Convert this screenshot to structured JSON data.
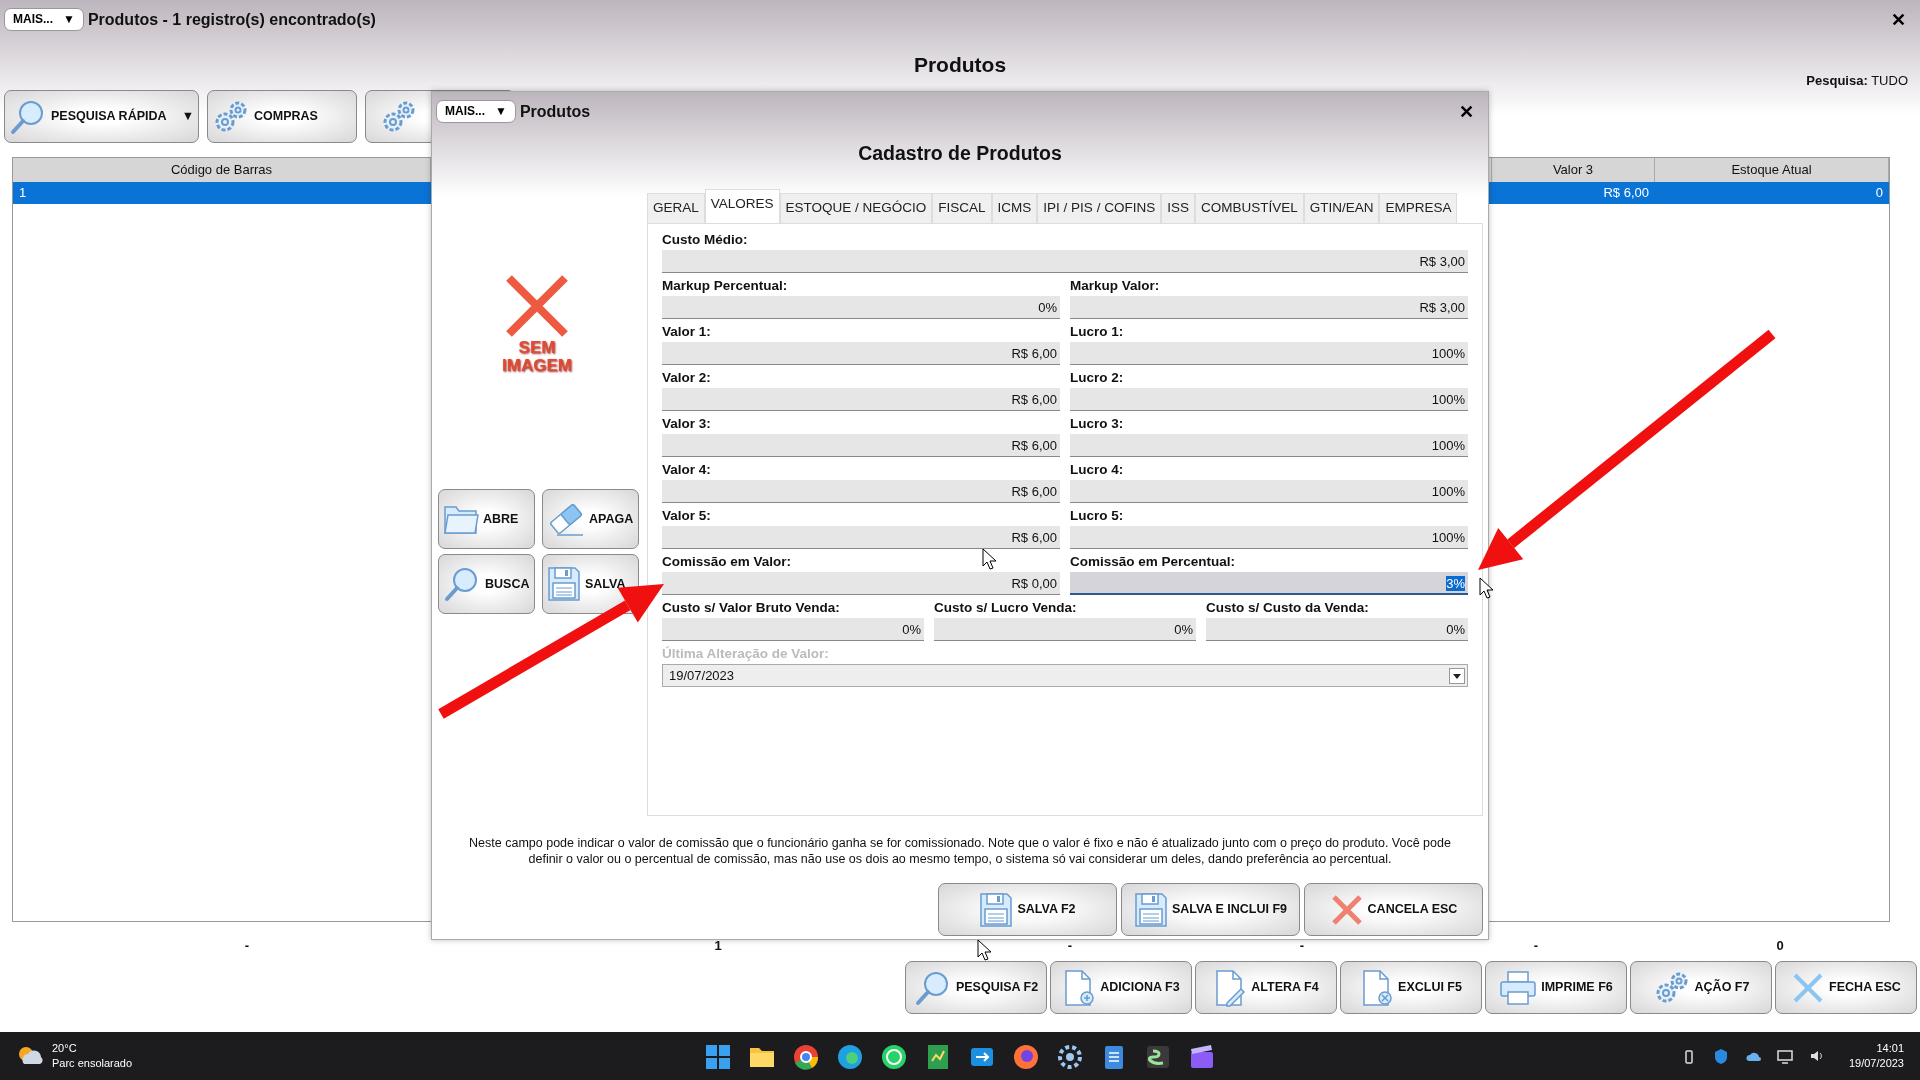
{
  "window": {
    "menu_button": {
      "label": "MAIS...",
      "caret": "▼"
    },
    "title": "Produtos - 1 registro(s) encontrado(s)",
    "close": "✕",
    "heading": "Produtos",
    "search_scope": "**Pesquisa:** TUDO"
  },
  "toolbar": [
    {
      "kind": "button",
      "label": "PESQUISA RÁPIDA",
      "caret": "▼"
    },
    {
      "kind": "button",
      "label": "COMPRAS"
    },
    {
      "kind": "icon-only"
    }
  ],
  "table": {
    "columns": [
      "Código de Barras",
      "Valor 3",
      "Estoque Atual"
    ],
    "rows": [
      {
        "selected": true,
        "cells": [
          "1",
          "R$ 6,00",
          "0"
        ]
      }
    ],
    "totals": [
      "-",
      "1",
      "-",
      "-",
      "-",
      "0"
    ]
  },
  "dialog": {
    "menu_button": {
      "label": "MAIS...",
      "caret": "▼"
    },
    "title": "Produtos",
    "close": "✕",
    "heading": "Cadastro de Produtos",
    "image_placeholder": "SEM IMAGEM",
    "side_buttons": [
      "ABRE",
      "APAGA",
      "BUSCA",
      "SALVA"
    ],
    "tabs": [
      {
        "label": "GERAL",
        "selected": false
      },
      {
        "label": "VALORES",
        "selected": true
      },
      {
        "label": "ESTOQUE / NEGÓCIO",
        "selected": false
      },
      {
        "label": "FISCAL",
        "selected": false
      },
      {
        "label": "ICMS",
        "selected": false
      },
      {
        "label": "IPI / PIS / COFINS",
        "selected": false
      },
      {
        "label": "ISS",
        "selected": false
      },
      {
        "label": "COMBUSTÍVEL",
        "selected": false
      },
      {
        "label": "GTIN/EAN",
        "selected": false
      },
      {
        "label": "EMPRESA",
        "selected": false
      }
    ],
    "field_rows": [
      [
        {
          "kind": "text",
          "label": "Custo Médio:",
          "value": "R$ 3,00",
          "focused": false,
          "disabled": false
        }
      ],
      [
        {
          "kind": "text",
          "label": "Markup Percentual:",
          "value": "0%",
          "focused": false,
          "disabled": false
        },
        {
          "kind": "text",
          "label": "Markup Valor:",
          "value": "R$ 3,00",
          "focused": false,
          "disabled": false
        }
      ],
      [
        {
          "kind": "text",
          "label": "Valor 1:",
          "value": "R$ 6,00",
          "focused": false,
          "disabled": false
        },
        {
          "kind": "text",
          "label": "Lucro 1:",
          "value": "100%",
          "focused": false,
          "disabled": false
        }
      ],
      [
        {
          "kind": "text",
          "label": "Valor 2:",
          "value": "R$ 6,00",
          "focused": false,
          "disabled": false
        },
        {
          "kind": "text",
          "label": "Lucro 2:",
          "value": "100%",
          "focused": false,
          "disabled": false
        }
      ],
      [
        {
          "kind": "text",
          "label": "Valor 3:",
          "value": "R$ 6,00",
          "focused": false,
          "disabled": false
        },
        {
          "kind": "text",
          "label": "Lucro 3:",
          "value": "100%",
          "focused": false,
          "disabled": false
        }
      ],
      [
        {
          "kind": "text",
          "label": "Valor 4:",
          "value": "R$ 6,00",
          "focused": false,
          "disabled": false
        },
        {
          "kind": "text",
          "label": "Lucro 4:",
          "value": "100%",
          "focused": false,
          "disabled": false
        }
      ],
      [
        {
          "kind": "text",
          "label": "Valor 5:",
          "value": "R$ 6,00",
          "focused": false,
          "disabled": false
        },
        {
          "kind": "text",
          "label": "Lucro 5:",
          "value": "100%",
          "focused": false,
          "disabled": false
        }
      ],
      [
        {
          "kind": "text",
          "label": "Comissão em Valor:",
          "value": "R$ 0,00",
          "focused": false,
          "disabled": false
        },
        {
          "kind": "text",
          "label": "Comissão em Percentual:",
          "value": "3%",
          "focused": true,
          "disabled": false
        }
      ],
      [
        {
          "kind": "text",
          "label": "Custo s/ Valor Bruto Venda:",
          "value": "0%",
          "focused": false,
          "disabled": false
        },
        {
          "kind": "text",
          "label": "Custo s/ Lucro Venda:",
          "value": "0%",
          "focused": false,
          "disabled": false
        },
        {
          "kind": "text",
          "label": "Custo s/ Custo da Venda:",
          "value": "0%",
          "focused": false,
          "disabled": false
        }
      ],
      [
        {
          "kind": "select",
          "label": "Última Alteração de Valor:",
          "value": "19/07/2023",
          "focused": false,
          "disabled": true
        }
      ]
    ],
    "help_text": "Neste campo pode indicar o valor de comissão que o funcionário ganha se for comissionado. Note que o valor é fixo e não é atualizado junto com o preço do produto. Você pode definir o valor ou o percentual de comissão, mas não use os dois ao mesmo tempo, o sistema só vai considerar um deles, dando preferência ao percentual.",
    "buttons": [
      "SALVA F2",
      "SALVA E INCLUI F9",
      "CANCELA ESC"
    ]
  },
  "actions": [
    "PESQUISA F2",
    "ADICIONA F3",
    "ALTERA F4",
    "EXCLUI F5",
    "IMPRIME F6",
    "AÇÃO F7",
    "FECHA ESC"
  ],
  "taskbar": {
    "temperature": "20°C",
    "weather": "Parc ensolarado",
    "time": "14:01",
    "date": "19/07/2023"
  }
}
